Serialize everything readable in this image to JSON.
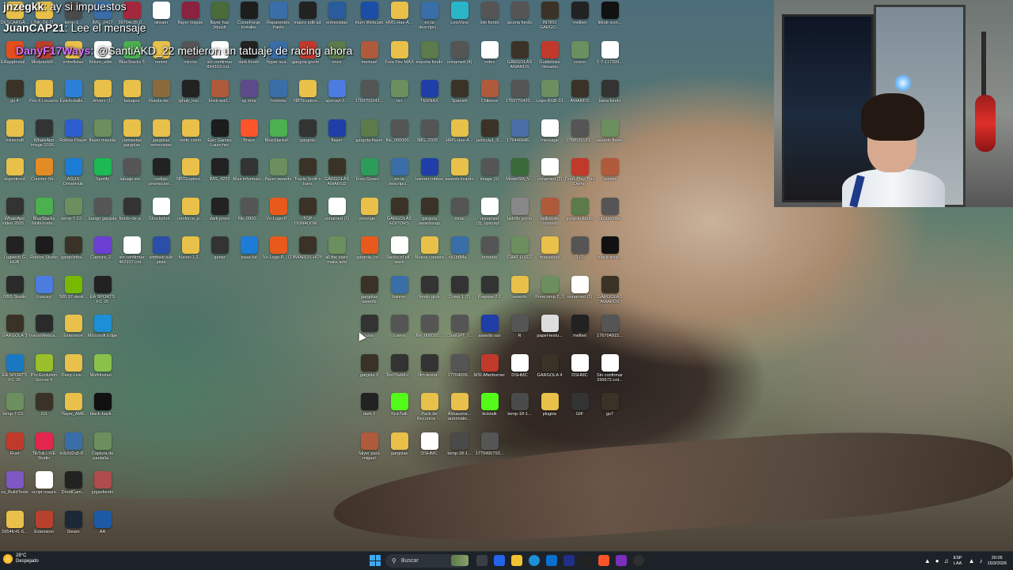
{
  "chat": [
    {
      "user": "jnzegkk",
      "sep": ":",
      "message": "ay si impuestos"
    },
    {
      "user": "JuanCAP21",
      "sep": ":",
      "message": "Lee el mensaje"
    },
    {
      "user": "DanyF17Ways",
      "sep": ":",
      "message": "@SantiAKD_22 metieron un tatuaje de racing ahora"
    }
  ],
  "desktop_icons": [
    {
      "label": "DESCARGA...",
      "color": "#e8c04a"
    },
    {
      "label": "LINK-DE-D...",
      "color": "#e8c04a"
    },
    {
      "label": "temp-1...",
      "color": "#4a4a4a"
    },
    {
      "label": "IMG_2417",
      "color": "#3a6ea8"
    },
    {
      "label": "EAappInstal...",
      "color": "#e44e1c"
    },
    {
      "label": "ModpackM...",
      "color": "#b8412e"
    },
    {
      "label": "entrefistas",
      "color": "#e8c04a"
    },
    {
      "label": "fixture_elim...",
      "color": "#ffffff"
    },
    {
      "label": "gs 4",
      "color": "#3a3226"
    },
    {
      "label": "Pes 6 Locazos",
      "color": "#e8c04a"
    },
    {
      "label": "EpicInstalle...",
      "color": "#2b7fd6"
    },
    {
      "label": "drivers (1)",
      "color": "#e8c04a"
    },
    {
      "label": "minecraft",
      "color": "#e8c04a"
    },
    {
      "label": "WhatsApp Image 2026...",
      "color": "#333"
    },
    {
      "label": "Roblox Player",
      "color": "#2c5ecf"
    },
    {
      "label": "flayer maceta",
      "color": "#6b8f5e"
    },
    {
      "label": "argentinod",
      "color": "#e8c04a"
    },
    {
      "label": "Counter-Str...",
      "color": "#e58b24"
    },
    {
      "label": "ASUS DriverHub",
      "color": "#1c7cd6"
    },
    {
      "label": "Spotify",
      "color": "#1db954"
    },
    {
      "label": "WhatsApp Video 2025...",
      "color": "#333"
    },
    {
      "label": "BlueStacks Multi-Insta...",
      "color": "#4caf50"
    },
    {
      "label": "temp-7-23...",
      "color": "#6b8f5e"
    },
    {
      "label": "bango gargola",
      "color": "#555"
    },
    {
      "label": "Logitech G HUB",
      "color": "#222"
    },
    {
      "label": "Roblox Studio",
      "color": "#1c1c1c"
    },
    {
      "label": "gargolinha...",
      "color": "#3a3226"
    },
    {
      "label": "Capture_2...",
      "color": "#6a3fd1"
    },
    {
      "label": "OBS Studio",
      "color": "#2a2a2a"
    },
    {
      "label": "Upscayl",
      "color": "#4c7ce0"
    },
    {
      "label": "580.97-desk...",
      "color": "#76b900"
    },
    {
      "label": "EA SPORTS FC 26",
      "color": "#222"
    },
    {
      "label": "GARGOLA 3",
      "color": "#3a3226"
    },
    {
      "label": "InsumWebca...",
      "color": "#2a2a2a"
    },
    {
      "label": "Extension",
      "color": "#e8c04a"
    },
    {
      "label": "Microsoft Edge",
      "color": "#1d8fd6"
    },
    {
      "label": "EA SPORTS FC 26",
      "color": "#1a78c2"
    },
    {
      "label": "Pro Evolution Soccer 6",
      "color": "#9bbf2a"
    },
    {
      "label": "Deep-Live...",
      "color": "#e8c04a"
    },
    {
      "label": "MultiInstan...",
      "color": "#8ac14b"
    },
    {
      "label": "temp-7-23...",
      "color": "#6b8f5e"
    },
    {
      "label": "GS",
      "color": "#3a3226"
    },
    {
      "label": "flayer_AME",
      "color": "#e8c04a"
    },
    {
      "label": "black-back...",
      "color": "#111"
    },
    {
      "label": "Rust",
      "color": "#c1392b"
    },
    {
      "label": "TikTok LIVE Studio",
      "color": "#e2264d"
    },
    {
      "label": "bcb2d2a5-8...",
      "color": "#3a6ea8"
    },
    {
      "label": "Captura de pantalla...",
      "color": "#6b8f5e"
    },
    {
      "label": "vs_BuildTools",
      "color": "#7e57c2"
    },
    {
      "label": "script mauro",
      "color": "#ffffff"
    },
    {
      "label": "DroidCam...",
      "color": "#222"
    },
    {
      "label": "grgasfondo",
      "color": "#b04c4c"
    },
    {
      "label": "2d54fc41-5...",
      "color": "#e8c04a"
    },
    {
      "label": "Extension",
      "color": "#b8412e"
    },
    {
      "label": "Steam",
      "color": "#1b2838"
    },
    {
      "label": "AA",
      "color": "#1c5aa6"
    },
    {
      "label": "39704c35-0...",
      "color": "#a3283e"
    },
    {
      "label": "stream",
      "color": "#ffffff"
    },
    {
      "label": "flayer miguel",
      "color": "#8a2240"
    },
    {
      "label": "flayer hax 3dusdt",
      "color": "#4a6b3a"
    },
    {
      "label": "CurseForge Installer",
      "color": "#1d1d1d"
    },
    {
      "label": "Reparentes Paolo",
      "color": "#3a6ea8"
    },
    {
      "label": "mauro edit ad",
      "color": "#222"
    },
    {
      "label": "entrevistas",
      "color": "#2a5b9c"
    },
    {
      "label": "BlueStacks 5",
      "color": "#4caf50"
    },
    {
      "label": "remini",
      "color": "#e8c04a"
    },
    {
      "label": "micros",
      "color": "#555"
    },
    {
      "label": "sin confirmar 894333.crd...",
      "color": "#ffffff"
    },
    {
      "label": "dark fondo",
      "color": "#222"
    },
    {
      "label": "hyper-sca...",
      "color": "#3a6ea8"
    },
    {
      "label": "gargola gnom...",
      "color": "#c1392b"
    },
    {
      "label": "once",
      "color": "#5c7a4a"
    },
    {
      "label": "tatuajes",
      "color": "#e8c04a"
    },
    {
      "label": "Rueda-de-...",
      "color": "#8a6a3a"
    },
    {
      "label": "lghub_inst...",
      "color": "#222"
    },
    {
      "label": "brick-wall...",
      "color": "#b05a3c"
    },
    {
      "label": "sg mira",
      "color": "#5c4a8a"
    },
    {
      "label": "tormeta",
      "color": "#3a6ea8"
    },
    {
      "label": "NBTExplore...",
      "color": "#e8c04a"
    },
    {
      "label": "upscayl-2...",
      "color": "#4c7ce0"
    },
    {
      "label": "camisetas gargolas",
      "color": "#e8c04a"
    },
    {
      "label": "gargolas entrevistas",
      "color": "#e8c04a"
    },
    {
      "label": "mofo cstrts",
      "color": "#e8c04a"
    },
    {
      "label": "Epic Games Launcher",
      "color": "#1c1c1c"
    },
    {
      "label": "Brave",
      "color": "#fb542b"
    },
    {
      "label": "BlueStacksl...",
      "color": "#4caf50"
    },
    {
      "label": "gargola",
      "color": "#333"
    },
    {
      "label": "flayer",
      "color": "#1f3ea8"
    },
    {
      "label": "tatuaje sin...",
      "color": "#555"
    },
    {
      "label": "codigo promocion...",
      "color": "#222"
    },
    {
      "label": "NBTExplore...",
      "color": "#e8c04a"
    },
    {
      "label": "IMG_4253",
      "color": "#222"
    },
    {
      "label": "Mas informaci...",
      "color": "#333"
    },
    {
      "label": "flayer awards",
      "color": "#6b8f5e"
    },
    {
      "label": "Travis Scott x barti",
      "color": "#3a3226"
    },
    {
      "label": "GARGOLAS AWARSD",
      "color": "#3a3226"
    },
    {
      "label": "fondo-de-a...",
      "color": "#333"
    },
    {
      "label": "Shockphot...",
      "color": "#ffffff"
    },
    {
      "label": "reinforce_p...",
      "color": "#e8c04a"
    },
    {
      "label": "dark jones",
      "color": "#222"
    },
    {
      "label": "file_0000...",
      "color": "#555"
    },
    {
      "label": "Vs-Logo-P...",
      "color": "#e85a1c"
    },
    {
      "label": "TOP DONADOR...",
      "color": "#3a3226"
    },
    {
      "label": "unnamed (1)",
      "color": "#ffffff"
    },
    {
      "label": "sin confirmar 462937.crd...",
      "color": "#ffffff"
    },
    {
      "label": "simbolo sub piola",
      "color": "#2b4ea8"
    },
    {
      "label": "fusion-1.2...",
      "color": "#e8c04a"
    },
    {
      "label": "ganar",
      "color": "#333"
    },
    {
      "label": "pasa fut",
      "color": "#1c7cd6"
    },
    {
      "label": "Vs-Logo-P... (1)",
      "color": "#e85a1c"
    },
    {
      "label": "AWARDS HOY",
      "color": "#3a3226"
    },
    {
      "label": "all the stars make add",
      "color": "#6b8f5e"
    },
    {
      "label": "Irium Webcam",
      "color": "#1c4ea8"
    },
    {
      "label": "HMS.Hax-A...",
      "color": "#e8c04a"
    },
    {
      "label": "en la descripci...",
      "color": "#3a6ea8"
    },
    {
      "label": "LetsView",
      "color": "#2bb5c9"
    },
    {
      "label": "lolo fondo",
      "color": "#555"
    },
    {
      "label": "lacoria fondo",
      "color": "#555"
    },
    {
      "label": "INTRO GARGO...",
      "color": "#3a3226"
    },
    {
      "label": "melbet",
      "color": "#222"
    },
    {
      "label": "tiktok-icon...",
      "color": "#111"
    },
    {
      "label": "memuel",
      "color": "#b05a3c"
    },
    {
      "label": "Free Fire MAX",
      "color": "#e8c04a"
    },
    {
      "label": "maceta fondo",
      "color": "#5c7a4a"
    },
    {
      "label": "unnamed (4)",
      "color": "#555"
    },
    {
      "label": "votos",
      "color": "#ffffff"
    },
    {
      "label": "GARGOLAS AWARDS",
      "color": "#3a3226"
    },
    {
      "label": "Guidelines Streams",
      "color": "#c1392b"
    },
    {
      "label": "ccerro",
      "color": "#6b8f5e"
    },
    {
      "label": "1-7-117399...",
      "color": "#ffffff"
    },
    {
      "label": "1769759242...",
      "color": "#555"
    },
    {
      "label": "tivi",
      "color": "#6b8f5e"
    },
    {
      "label": "TERNAS",
      "color": "#1f3ea8"
    },
    {
      "label": "Spanish",
      "color": "#3a3226"
    },
    {
      "label": "Chilenos",
      "color": "#b05a3c"
    },
    {
      "label": "1769770420...",
      "color": "#555"
    },
    {
      "label": "Logo-RGB-01",
      "color": "#6b8f5e"
    },
    {
      "label": "AWARDS",
      "color": "#3a3226"
    },
    {
      "label": "bana fondo",
      "color": "#333"
    },
    {
      "label": "gargola-flayer",
      "color": "#5c7a4a"
    },
    {
      "label": "file_000000...",
      "color": "#555"
    },
    {
      "label": "IMG_2025...",
      "color": "#555"
    },
    {
      "label": "HMS.Hax-A...",
      "color": "#e8c04a"
    },
    {
      "label": "pelicula1_9...",
      "color": "#3a3226"
    },
    {
      "label": "176446646...",
      "color": "#4a6ea8"
    },
    {
      "label": "message",
      "color": "#ffffff"
    },
    {
      "label": "1768539181...",
      "color": "#555"
    },
    {
      "label": "awards flayer",
      "color": "#6b8f5e"
    },
    {
      "label": "Free-Green...",
      "color": "#2b9c5a"
    },
    {
      "label": "en la descripci...",
      "color": "#3a6ea8"
    },
    {
      "label": "banner robbet",
      "color": "#1f3ea8"
    },
    {
      "label": "awards lizardo",
      "color": "#e8c04a"
    },
    {
      "label": "image (1)",
      "color": "#555"
    },
    {
      "label": "ModelSM_V...",
      "color": "#3a6a3a"
    },
    {
      "label": "unnamed (2)",
      "color": "#ffffff"
    },
    {
      "label": "Don't Play This Demo",
      "color": "#c1392b"
    },
    {
      "label": "memo",
      "color": "#b05a3c"
    },
    {
      "label": "prestige...",
      "color": "#e8c04a"
    },
    {
      "label": "GARGOLAS EDITORS",
      "color": "#3a3226"
    },
    {
      "label": "gargola awardssap",
      "color": "#3a3226"
    },
    {
      "label": "moai",
      "color": "#555"
    },
    {
      "label": "unnamed (3)_upscayl...",
      "color": "#ffffff"
    },
    {
      "label": "ladrillo gricio",
      "color": "#888"
    },
    {
      "label": "bellido de unidad",
      "color": "#b05a3c"
    },
    {
      "label": "gargola fondo",
      "color": "#5c7a4a"
    },
    {
      "label": "unsuscribe",
      "color": "#555"
    },
    {
      "label": "gargola_co...",
      "color": "#e85a1c"
    },
    {
      "label": "Stacks of pil... stuck",
      "color": "#ffffff"
    },
    {
      "label": "Nueva carpeta",
      "color": "#e8c04a"
    },
    {
      "label": "cb1b8f4a...",
      "color": "#3a6ea8"
    },
    {
      "label": "tornado",
      "color": "#555"
    },
    {
      "label": "CHAT LIVES",
      "color": "#6b8f5e"
    },
    {
      "label": "mapashax",
      "color": "#e8c04a"
    },
    {
      "label": "R (1)",
      "color": "#555"
    },
    {
      "label": "black-scre...",
      "color": "#111"
    },
    {
      "label": "gargolas awards",
      "color": "#3a3226"
    },
    {
      "label": "banner",
      "color": "#3a6ea8"
    },
    {
      "label": "fondo glob",
      "color": "#333"
    },
    {
      "label": "Comp 1 (2)",
      "color": "#333"
    },
    {
      "label": "Preprpe-2.1",
      "color": "#333"
    },
    {
      "label": "awards",
      "color": "#e8c04a"
    },
    {
      "label": "Preecomp 2_1",
      "color": "#6b8f5e"
    },
    {
      "label": "unnamed (2)",
      "color": "#ffffff"
    },
    {
      "label": "GARGOLAS AWARDS",
      "color": "#3a3226"
    },
    {
      "label": "luna",
      "color": "#333"
    },
    {
      "label": "cueva",
      "color": "#555"
    },
    {
      "label": "file_000000...",
      "color": "#555"
    },
    {
      "label": "ChatGPT_I...",
      "color": "#555"
    },
    {
      "label": "awards sss",
      "color": "#1f3ea8"
    },
    {
      "label": "R",
      "color": "#555"
    },
    {
      "label": "papel-textu...",
      "color": "#dddddd"
    },
    {
      "label": "melbet",
      "color": "#222"
    },
    {
      "label": "176704915...",
      "color": "#555"
    },
    {
      "label": "gargola 2",
      "color": "#3a3226"
    },
    {
      "label": "3bd70a9d-c...",
      "color": "#333"
    },
    {
      "label": "film-textur...",
      "color": "#333"
    },
    {
      "label": "17704009...",
      "color": "#555"
    },
    {
      "label": "MSI Afterburner",
      "color": "#c1392b"
    },
    {
      "label": "DSHMC",
      "color": "#ffffff"
    },
    {
      "label": "GARGOLA 4",
      "color": "#3a3226"
    },
    {
      "label": "DSHMC",
      "color": "#ffffff"
    },
    {
      "label": "Sin confirmar 336672.crd...",
      "color": "#ffffff"
    },
    {
      "label": "dark 2",
      "color": "#222"
    },
    {
      "label": "KickTalk",
      "color": "#53fc18"
    },
    {
      "label": "Pack de Recursos -...",
      "color": "#e8c04a"
    },
    {
      "label": "Almacena... automátic...",
      "color": "#e8c04a"
    },
    {
      "label": "kicktalk",
      "color": "#53fc18"
    },
    {
      "label": "temp-18-1...",
      "color": "#4a4a4a"
    },
    {
      "label": "plugins",
      "color": "#e8c04a"
    },
    {
      "label": "GIF",
      "color": "#333"
    },
    {
      "label": "gs7",
      "color": "#3a3226"
    },
    {
      "label": "falyer para miguel",
      "color": "#b05a3c"
    },
    {
      "label": "gargolas",
      "color": "#e8c04a"
    },
    {
      "label": "DSHMC",
      "color": "#ffffff"
    },
    {
      "label": "temp-18-1...",
      "color": "#4a4a4a"
    },
    {
      "label": "1770490793...",
      "color": "#555"
    }
  ],
  "taskbar": {
    "weather_temp": "28°C",
    "weather_desc": "Despejado",
    "search_placeholder": "Buscar",
    "lang_line1": "ESP",
    "lang_line2": "LAA",
    "time": "20:05",
    "date": "15/3/2026"
  },
  "colors": {
    "taskbar_bg": "#1d2228",
    "accent": "#3ea7f0"
  }
}
